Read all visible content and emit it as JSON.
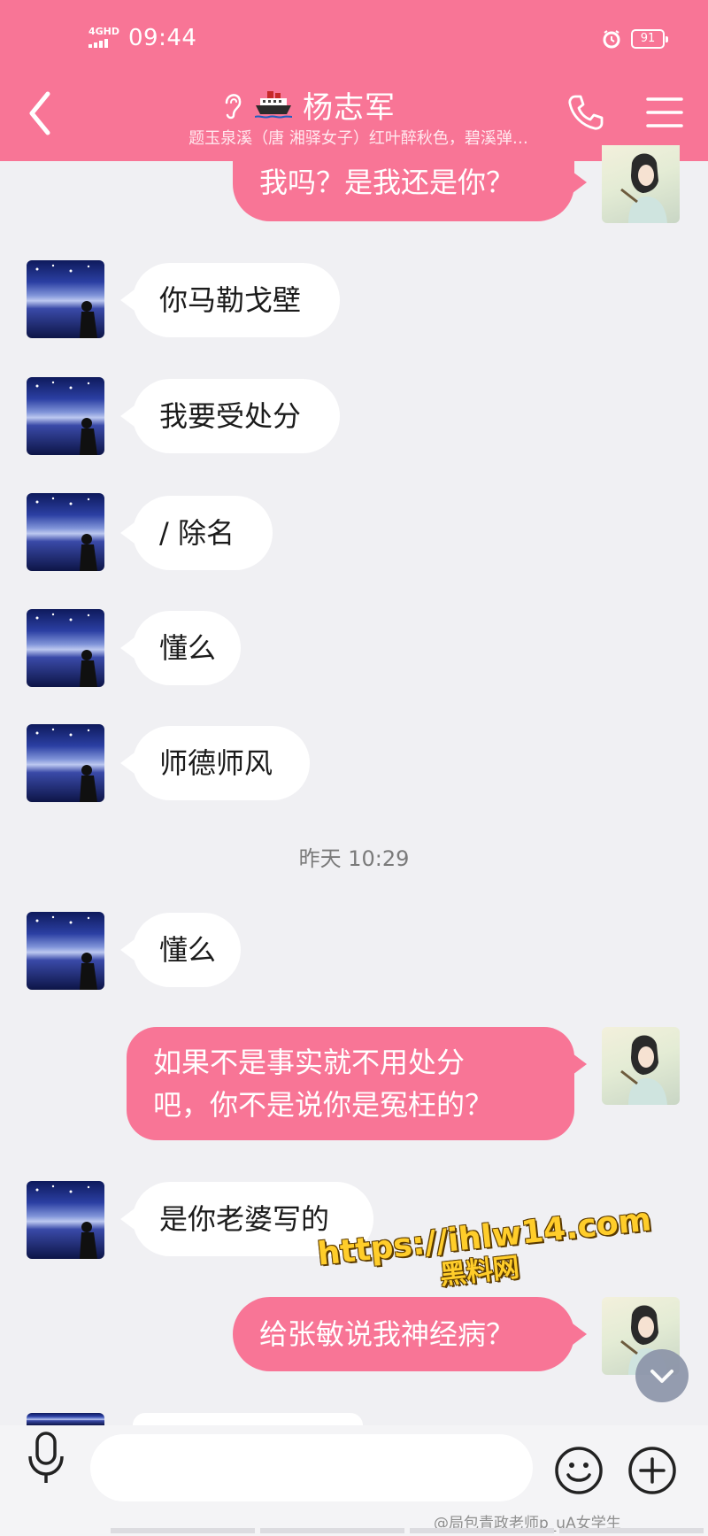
{
  "status_bar": {
    "network": "4GHD",
    "time": "09:44",
    "battery": "91"
  },
  "header": {
    "contact_name": "杨志军",
    "subtitle": "题玉泉溪（唐 湘驿女子）红叶醉秋色，碧溪弹…",
    "icons": [
      "back-icon",
      "ear-icon",
      "ship-icon",
      "phone-icon",
      "menu-icon"
    ]
  },
  "messages": [
    {
      "sender": "self",
      "text": "我吗？是我还是你？"
    },
    {
      "sender": "other",
      "text": "你马勒戈壁"
    },
    {
      "sender": "other",
      "text": "我要受处分"
    },
    {
      "sender": "other",
      "text": "/ 除名"
    },
    {
      "sender": "other",
      "text": "懂么"
    },
    {
      "sender": "other",
      "text": "师德师风"
    },
    {
      "sender": "other",
      "text": "懂么"
    },
    {
      "sender": "self",
      "lines": [
        "如果不是事实就不用处分",
        "吧，你不是说你是冤枉的？"
      ]
    },
    {
      "sender": "other",
      "text": "是你老婆写的"
    },
    {
      "sender": "self",
      "text": "给张敏说我神经病？"
    }
  ],
  "timestamp": "昨天 10:29",
  "watermark": {
    "url": "https://ihlw14.com",
    "label": "黑料网"
  },
  "input_bar": {
    "placeholder": "",
    "icons": [
      "voice-icon",
      "emoji-icon",
      "plus-icon"
    ]
  },
  "footer_credit": "@局包青政老师p_uA女学生",
  "colors": {
    "accent": "#f87596",
    "background": "#f0f0f3",
    "bubble_in": "#ffffff"
  }
}
